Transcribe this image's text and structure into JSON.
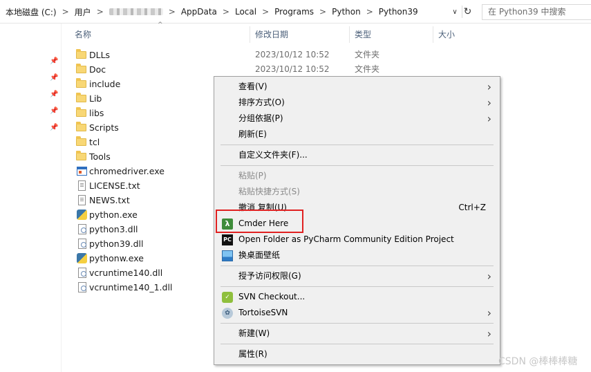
{
  "address_bar": {
    "crumbs": [
      "本地磁盘 (C:)",
      "用户",
      "AppData",
      "Local",
      "Programs",
      "Python",
      "Python39"
    ],
    "separator": ">",
    "dropdown_glyph": "∨",
    "refresh_glyph": "↻",
    "search_placeholder": "在 Python39 中搜索"
  },
  "columns": {
    "name": "名称",
    "modified": "修改日期",
    "type": "类型",
    "size": "大小",
    "sort_glyph": "^"
  },
  "files": [
    {
      "name": "DLLs",
      "date": "2023/10/12 10:52",
      "type": "文件夹",
      "icon": "folder-icon"
    },
    {
      "name": "Doc",
      "date": "2023/10/12 10:52",
      "type": "文件夹",
      "icon": "folder-icon"
    },
    {
      "name": "include",
      "icon": "folder-icon"
    },
    {
      "name": "Lib",
      "icon": "folder-icon"
    },
    {
      "name": "libs",
      "icon": "folder-icon"
    },
    {
      "name": "Scripts",
      "icon": "folder-icon"
    },
    {
      "name": "tcl",
      "icon": "folder-icon"
    },
    {
      "name": "Tools",
      "icon": "folder-icon"
    },
    {
      "name": "chromedriver.exe",
      "icon": "exe-window-icon"
    },
    {
      "name": "LICENSE.txt",
      "icon": "text-file-icon"
    },
    {
      "name": "NEWS.txt",
      "icon": "text-file-icon"
    },
    {
      "name": "python.exe",
      "icon": "python-icon"
    },
    {
      "name": "python3.dll",
      "icon": "dll-file-icon"
    },
    {
      "name": "python39.dll",
      "icon": "dll-file-icon"
    },
    {
      "name": "pythonw.exe",
      "icon": "python-icon"
    },
    {
      "name": "vcruntime140.dll",
      "icon": "dll-file-icon"
    },
    {
      "name": "vcruntime140_1.dll",
      "icon": "dll-file-icon"
    }
  ],
  "context_menu": {
    "view": "查看(V)",
    "sort_by": "排序方式(O)",
    "group_by": "分组依据(P)",
    "refresh": "刷新(E)",
    "customize_folder": "自定义文件夹(F)...",
    "paste": "粘贴(P)",
    "paste_shortcut": "粘贴快捷方式(S)",
    "undo_copy": "撤消 复制(U)",
    "undo_copy_shortcut": "Ctrl+Z",
    "cmder_here": "Cmder Here",
    "open_pycharm": "Open Folder as PyCharm Community Edition Project",
    "change_wallpaper": "换桌面壁纸",
    "grant_access": "授予访问权限(G)",
    "svn_checkout": "SVN Checkout...",
    "tortoise_svn": "TortoiseSVN",
    "new": "新建(W)",
    "properties": "属性(R)",
    "submenu_glyph": "›"
  },
  "icon_glyphs": {
    "cmder": "λ",
    "pycharm": "PC",
    "svn_checkout": "✓",
    "tortoise": "✿",
    "pin": "📌"
  },
  "colors": {
    "highlight_box": "#e02020",
    "menu_background": "#f0f0f0",
    "folder": "#f8d775"
  },
  "watermark": "CSDN @棒棒棒糖"
}
